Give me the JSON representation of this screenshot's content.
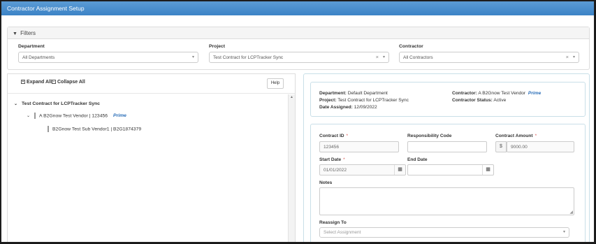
{
  "title": "Contractor Assignment Setup",
  "filters": {
    "heading": "Filters",
    "department": {
      "label": "Department",
      "value": "All Departments"
    },
    "project": {
      "label": "Project",
      "value": "Test Contract for LCPTracker Sync"
    },
    "contractor": {
      "label": "Contractor",
      "value": "All Contractors"
    }
  },
  "toolbar": {
    "expand_all": "Expand All",
    "collapse_all": "Collapse All",
    "help": "Help"
  },
  "tree": {
    "root": "Test Contract for LCPTracker Sync",
    "vendor": "A B2Gnow Test Vendor | 123456",
    "vendor_badge": "Prime",
    "sub": "B2Gnow Test Sub Vendor1 | B2G1874379"
  },
  "info": {
    "department_label": "Department:",
    "department_value": "Default Department",
    "project_label": "Project:",
    "project_value": "Test Contract for LCPTracker Sync",
    "date_label": "Date Assigned:",
    "date_value": "12/09/2022",
    "contractor_label": "Contractor:",
    "contractor_value": "A B2Gnow Test Vendor",
    "contractor_badge": "Prime",
    "status_label": "Contractor Status:",
    "status_value": "Active"
  },
  "form": {
    "contract_id_label": "Contract ID",
    "contract_id_value": "123456",
    "resp_code_label": "Responsibility Code",
    "resp_code_value": "",
    "amount_label": "Contract Amount",
    "currency": "$",
    "amount_value": "9000.00",
    "start_label": "Start Date",
    "start_value": "01/01/2022",
    "end_label": "End Date",
    "end_value": "",
    "notes_label": "Notes",
    "reassign_label": "Reassign To",
    "reassign_placeholder": "Select Assignment",
    "required_mark": "*"
  }
}
